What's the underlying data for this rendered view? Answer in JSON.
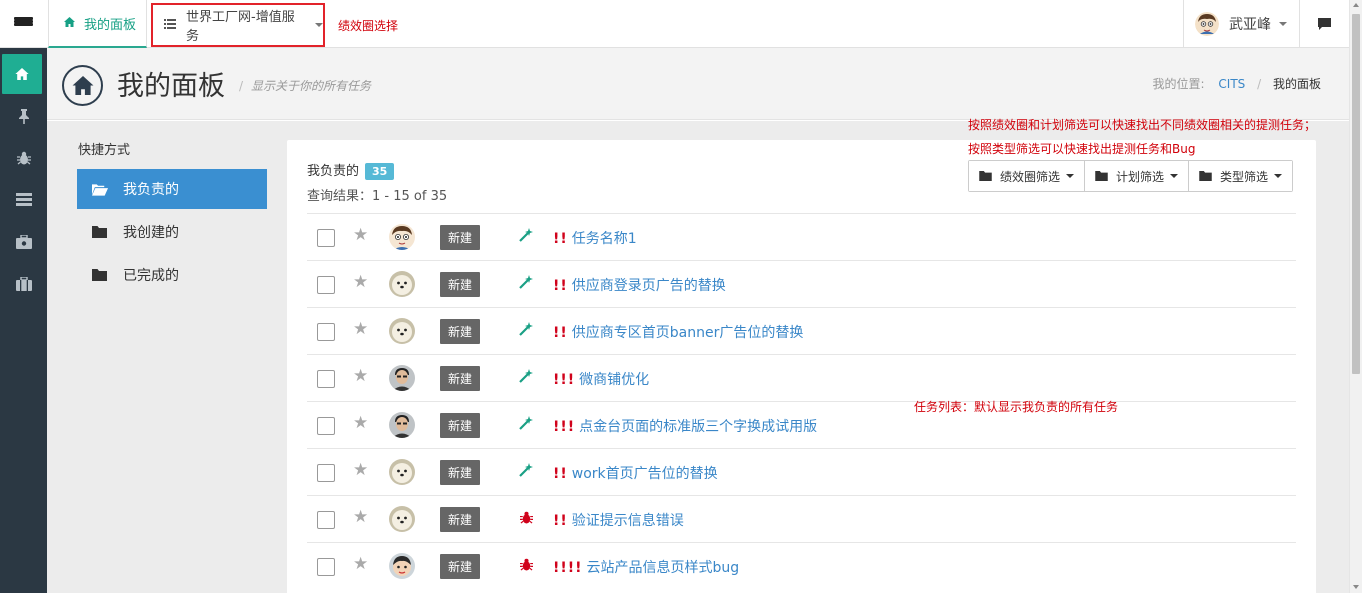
{
  "topbar": {
    "home_tab": "我的面板",
    "group_select": "世界工厂网-增值服务",
    "group_note": "绩效圈选择",
    "user_name": "武亚峰"
  },
  "page": {
    "title": "我的面板",
    "subtitle": "显示关于你的所有任务",
    "breadcrumb_label": "我的位置:",
    "breadcrumb_link": "CITS",
    "breadcrumb_current": "我的面板"
  },
  "sidebar_nav": [
    "home-icon",
    "pin-icon",
    "bug-icon",
    "list-icon",
    "briefcase-icon",
    "suitcase-icon"
  ],
  "shortcuts": {
    "title": "快捷方式",
    "items": [
      {
        "label": "我负责的",
        "active": true
      },
      {
        "label": "我创建的",
        "active": false
      },
      {
        "label": "已完成的",
        "active": false
      }
    ]
  },
  "panel": {
    "label": "我负责的",
    "count": "35",
    "result": "查询结果：1 - 15 of 35"
  },
  "filters": [
    "绩效圈筛选",
    "计划筛选",
    "类型筛选"
  ],
  "notes": {
    "filter_note_1": "按照绩效圈和计划筛选可以快速找出不同绩效圈相关的提测任务；",
    "filter_note_2": "按照类型筛选可以快速找出提测任务和Bug",
    "list_note": "任务列表：默认显示我负责的所有任务"
  },
  "tasks": [
    {
      "status": "新建",
      "type": "wand-icon",
      "priority": "!!",
      "title": "任务名称1",
      "avatar": "cartoon"
    },
    {
      "status": "新建",
      "type": "wand-icon",
      "priority": "!!",
      "title": "供应商登录页广告的替换",
      "avatar": "dog"
    },
    {
      "status": "新建",
      "type": "wand-icon",
      "priority": "!!",
      "title": "供应商专区首页banner广告位的替换",
      "avatar": "dog"
    },
    {
      "status": "新建",
      "type": "wand-icon",
      "priority": "!!!",
      "title": "微商铺优化",
      "avatar": "person"
    },
    {
      "status": "新建",
      "type": "wand-icon",
      "priority": "!!!",
      "title": "点金台页面的标准版三个字换成试用版",
      "avatar": "person"
    },
    {
      "status": "新建",
      "type": "wand-icon",
      "priority": "!!",
      "title": "work首页广告位的替换",
      "avatar": "dog"
    },
    {
      "status": "新建",
      "type": "bug-icon",
      "priority": "!!",
      "title": "验证提示信息错误",
      "avatar": "dog"
    },
    {
      "status": "新建",
      "type": "bug-icon",
      "priority": "!!!!",
      "title": "云站产品信息页样式bug",
      "avatar": "cartoon2"
    }
  ],
  "colors": {
    "accent": "#1fae93",
    "nav_bg": "#2b3843",
    "active_shortcut": "#3a8fd1",
    "badge": "#56b9d6",
    "annotation": "#d1000a",
    "link": "#3a87c8"
  }
}
